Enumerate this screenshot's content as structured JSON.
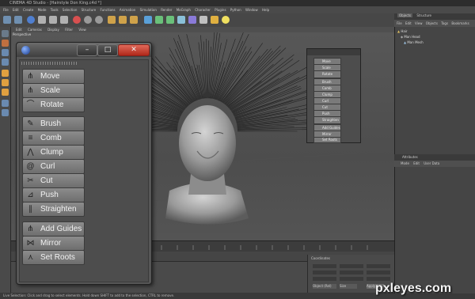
{
  "window": {
    "title": "CINEMA 4D Studio - [Hairstyle Don King.c4d *]"
  },
  "menubar": [
    "File",
    "Edit",
    "Create",
    "Mode",
    "Tools",
    "Selection",
    "Structure",
    "Functions",
    "Animation",
    "Simulation",
    "Render",
    "MoGraph",
    "Character",
    "Plugins",
    "Python",
    "Window",
    "Help"
  ],
  "viewport": {
    "menu": [
      "Edit",
      "Cameras",
      "Display",
      "Filter",
      "View"
    ],
    "label": "Perspective"
  },
  "hair_tools": {
    "groups": [
      {
        "items": [
          "Move",
          "Scale",
          "Rotate"
        ]
      },
      {
        "items": [
          "Brush",
          "Comb",
          "Clump",
          "Curl",
          "Cut",
          "Push",
          "Straighten"
        ]
      },
      {
        "items": [
          "Add Guides",
          "Mirror",
          "Set Roots"
        ]
      }
    ]
  },
  "small_palette": {
    "items": [
      "Move",
      "Scale",
      "Rotate",
      "Brush",
      "Comb",
      "Clump",
      "Curl",
      "Cut",
      "Push",
      "Straighten",
      "Add Guides",
      "Mirror",
      "Set Roots"
    ]
  },
  "object_manager": {
    "tabs": [
      "Objects",
      "Structure"
    ],
    "menu": [
      "File",
      "Edit",
      "View",
      "Objects",
      "Tags",
      "Bookmarks"
    ],
    "objects": [
      "Hair",
      "Man Head",
      "Man Mesh"
    ]
  },
  "attributes": {
    "title": "Attributes",
    "menu": [
      "Mode",
      "Edit",
      "User Data"
    ]
  },
  "coordinates": {
    "title": "Coordinates",
    "apply_label": "Apply",
    "mode": "Object (Rel)",
    "size_mode": "Size"
  },
  "status": {
    "text": "Live Selection: Click and drag to select elements. Hold down SHIFT to add to the selection, CTRL to remove."
  },
  "watermark": "pxleyes.com",
  "colors": {
    "button": "#7d7d7d",
    "close": "#c8392b",
    "panel": "#4d4d4d"
  }
}
